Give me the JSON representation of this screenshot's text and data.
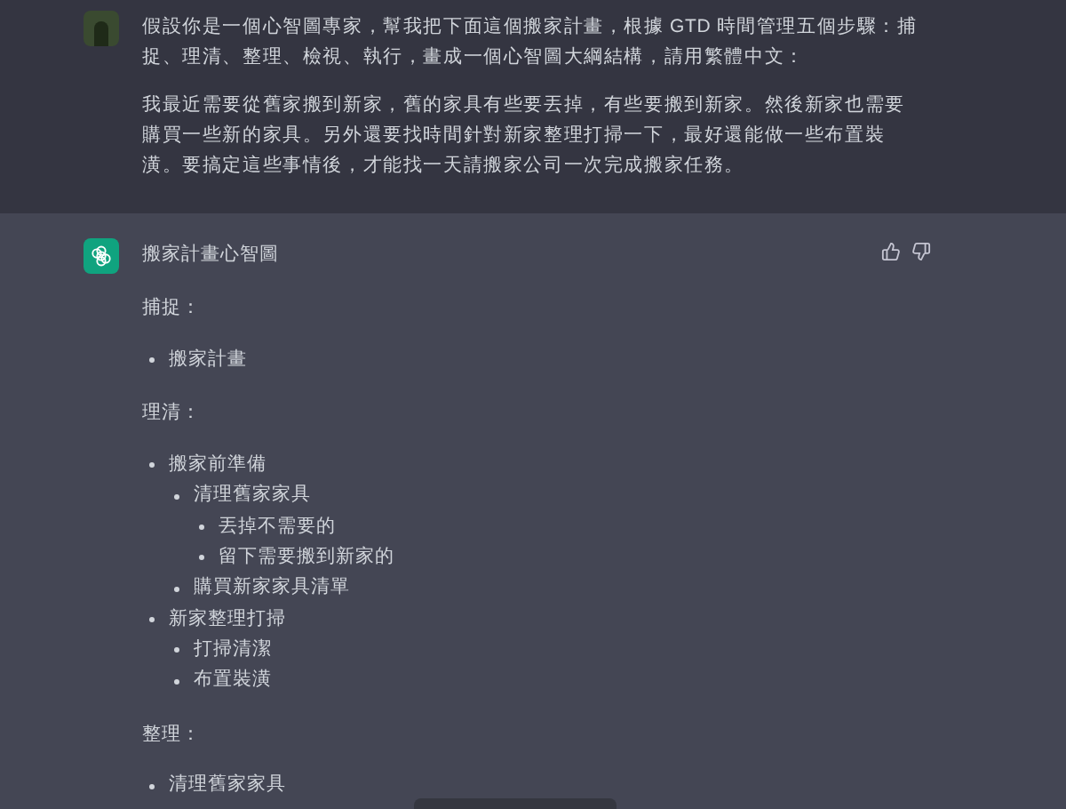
{
  "user_message": {
    "paragraphs": [
      "假設你是一個心智圖專家，幫我把下面這個搬家計畫，根據 GTD 時間管理五個步驟：捕捉、理清、整理、檢視、執行，畫成一個心智圖大綱結構，請用繁體中文：",
      "我最近需要從舊家搬到新家，舊的家具有些要丟掉，有些要搬到新家。然後新家也需要購買一些新的家具。另外還要找時間針對新家整理打掃一下，最好還能做一些布置裝潢。要搞定這些事情後，才能找一天請搬家公司一次完成搬家任務。"
    ]
  },
  "assistant_message": {
    "title": "搬家計畫心智圖",
    "sections": [
      {
        "heading": "捕捉：",
        "items": [
          {
            "text": "搬家計畫"
          }
        ]
      },
      {
        "heading": "理清：",
        "items": [
          {
            "text": "搬家前準備",
            "children": [
              {
                "text": "清理舊家家具",
                "children": [
                  {
                    "text": "丟掉不需要的"
                  },
                  {
                    "text": "留下需要搬到新家的"
                  }
                ]
              },
              {
                "text": "購買新家家具清單"
              }
            ]
          },
          {
            "text": "新家整理打掃",
            "children": [
              {
                "text": "打掃清潔"
              },
              {
                "text": "布置裝潢"
              }
            ]
          }
        ]
      },
      {
        "heading": "整理：",
        "items": [
          {
            "text": "清理舊家家具"
          }
        ]
      }
    ]
  }
}
